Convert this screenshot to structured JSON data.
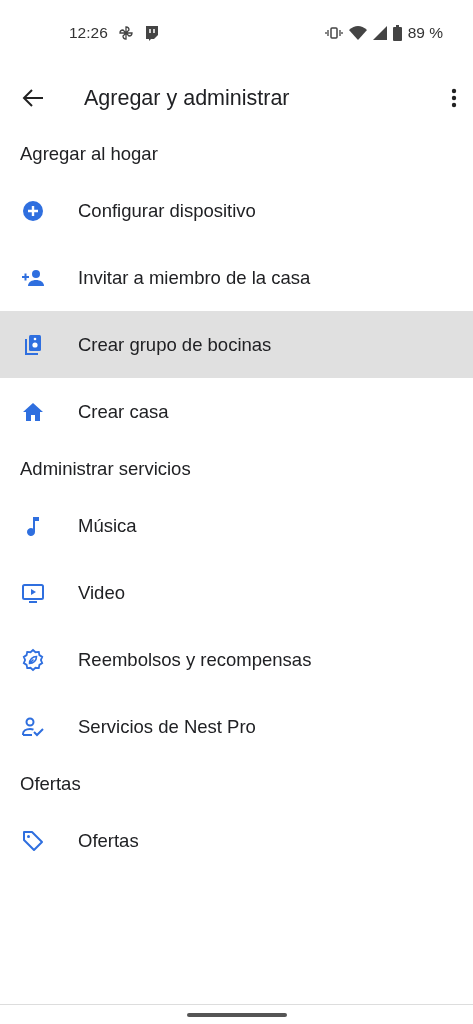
{
  "status_bar": {
    "time": "12:26",
    "battery": "89 %"
  },
  "app_bar": {
    "title": "Agregar y administrar"
  },
  "sections": [
    {
      "title": "Agregar al hogar",
      "items": [
        {
          "label": "Configurar dispositivo",
          "kind": "add",
          "selected": false
        },
        {
          "label": "Invitar a miembro de la casa",
          "kind": "invite",
          "selected": false
        },
        {
          "label": "Crear grupo de bocinas",
          "kind": "speaker",
          "selected": true
        },
        {
          "label": "Crear casa",
          "kind": "home",
          "selected": false
        }
      ]
    },
    {
      "title": "Administrar servicios",
      "items": [
        {
          "label": "Música",
          "kind": "music",
          "selected": false
        },
        {
          "label": "Video",
          "kind": "video",
          "selected": false
        },
        {
          "label": "Reembolsos y recompensas",
          "kind": "rewards",
          "selected": false
        },
        {
          "label": "Servicios de Nest Pro",
          "kind": "pro",
          "selected": false
        }
      ]
    },
    {
      "title": "Ofertas",
      "items": [
        {
          "label": "Ofertas",
          "kind": "offers",
          "selected": false
        }
      ]
    }
  ]
}
